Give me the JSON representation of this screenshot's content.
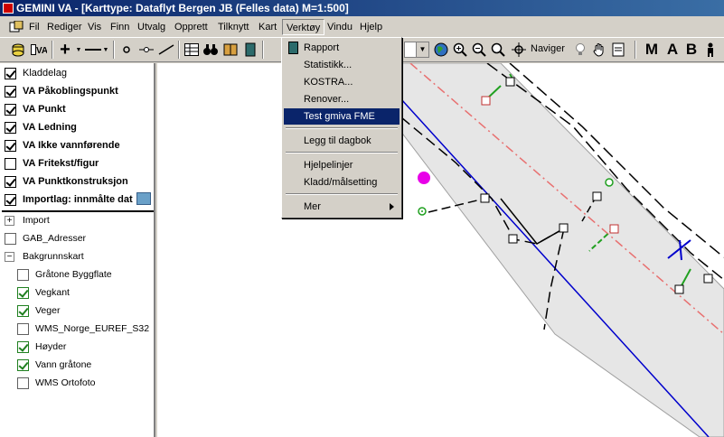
{
  "window": {
    "title": "GEMINI VA - [Karttype: Dataflyt Bergen JB (Felles data) M=1:500]"
  },
  "menubar": {
    "items": [
      "Fil",
      "Rediger",
      "Vis",
      "Finn",
      "Utvalg",
      "Opprett",
      "Tilknytt",
      "Kart",
      "Verktøy",
      "Vindu",
      "Hjelp"
    ],
    "active": "Verktøy"
  },
  "toolbar": {
    "naviger_label": "Naviger",
    "letters": [
      "M",
      "A",
      "B"
    ]
  },
  "verktoy_menu": {
    "items": [
      {
        "label": "Rapport"
      },
      {
        "label": "Statistikk..."
      },
      {
        "label": "KOSTRA..."
      },
      {
        "label": "Renover..."
      },
      {
        "label": "Test gmiva FME",
        "highlighted": true
      },
      {
        "label": "Legg til dagbok"
      },
      {
        "label": "Hjelpelinjer"
      },
      {
        "label": "Kladd/målsetting"
      },
      {
        "label": "Mer",
        "submenu": true
      }
    ]
  },
  "layers": {
    "top": [
      {
        "label": "Kladdelag",
        "checked": true,
        "bold": false
      },
      {
        "label": "VA Påkoblingspunkt",
        "checked": true,
        "bold": true
      },
      {
        "label": "VA Punkt",
        "checked": true,
        "bold": true
      },
      {
        "label": "VA Ledning",
        "checked": true,
        "bold": true
      },
      {
        "label": "VA Ikke vannførende",
        "checked": true,
        "bold": true
      },
      {
        "label": "VA Fritekst/figur",
        "checked": false,
        "bold": true
      },
      {
        "label": "VA Punktkonstruksjon",
        "checked": true,
        "bold": true
      },
      {
        "label": "Importlag: innmålte dat",
        "checked": true,
        "bold": true
      }
    ],
    "bottom": [
      {
        "label": "Import",
        "kind": "expander",
        "symbol": "+"
      },
      {
        "label": "GAB_Adresser",
        "kind": "checkbox",
        "checked": false
      },
      {
        "label": "Bakgrunnskart",
        "kind": "expander",
        "symbol": "−"
      },
      {
        "label": "Gråtone Byggflate",
        "kind": "sub",
        "checked": false,
        "green": false
      },
      {
        "label": "Vegkant",
        "kind": "sub",
        "checked": true,
        "green": true
      },
      {
        "label": "Veger",
        "kind": "sub",
        "checked": true,
        "green": true
      },
      {
        "label": "WMS_Norge_EUREF_S32",
        "kind": "sub",
        "checked": false,
        "green": false
      },
      {
        "label": "Høyder",
        "kind": "sub",
        "checked": true,
        "green": true
      },
      {
        "label": "Vann gråtone",
        "kind": "sub",
        "checked": true,
        "green": true
      },
      {
        "label": "WMS Ortofoto",
        "kind": "sub",
        "checked": false,
        "green": false
      }
    ]
  },
  "colors": {
    "selection": "#0a246a",
    "road_fill": "#e6e6e6",
    "pipe_blue": "#0000cc",
    "centerline_red": "#e87070",
    "point_magenta": "#e800e8",
    "connector_green": "#20a020"
  }
}
